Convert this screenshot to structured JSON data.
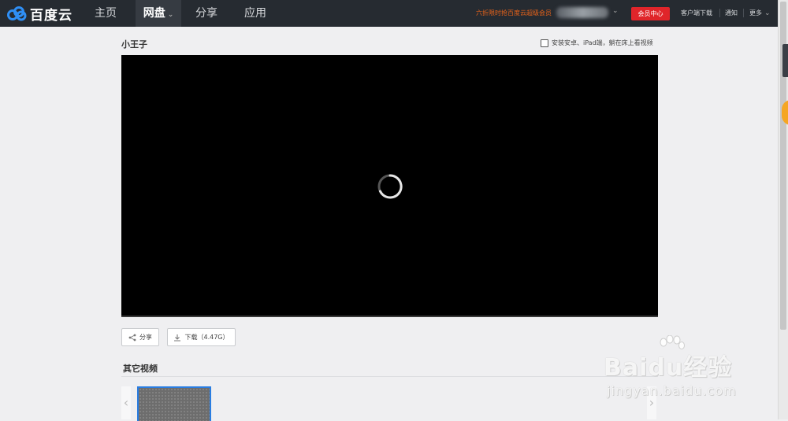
{
  "nav": {
    "brand": "百度云",
    "items": [
      {
        "label": "主页",
        "active": false
      },
      {
        "label": "网盘",
        "active": true
      },
      {
        "label": "分享",
        "active": false
      },
      {
        "label": "应用",
        "active": false
      }
    ],
    "promo": "六折限时抢百度云超级会员",
    "vip_button": "会员中心",
    "client_download": "客户端下载",
    "notifications": "通知",
    "more": "更多"
  },
  "video": {
    "title": "小王子",
    "install_option": "安装安卓、iPad端，躺在床上看视频"
  },
  "actions": {
    "share": "分享",
    "download": "下载（4.47G）"
  },
  "other_videos": {
    "title": "其它视频"
  },
  "watermark": {
    "brand": "Baidu经验",
    "url": "jingyan.baidu.com"
  },
  "colors": {
    "topbar": "#262b31",
    "vip_button": "#e0252a",
    "promo": "#e8631a",
    "selected_thumb": "#2a7de1"
  }
}
